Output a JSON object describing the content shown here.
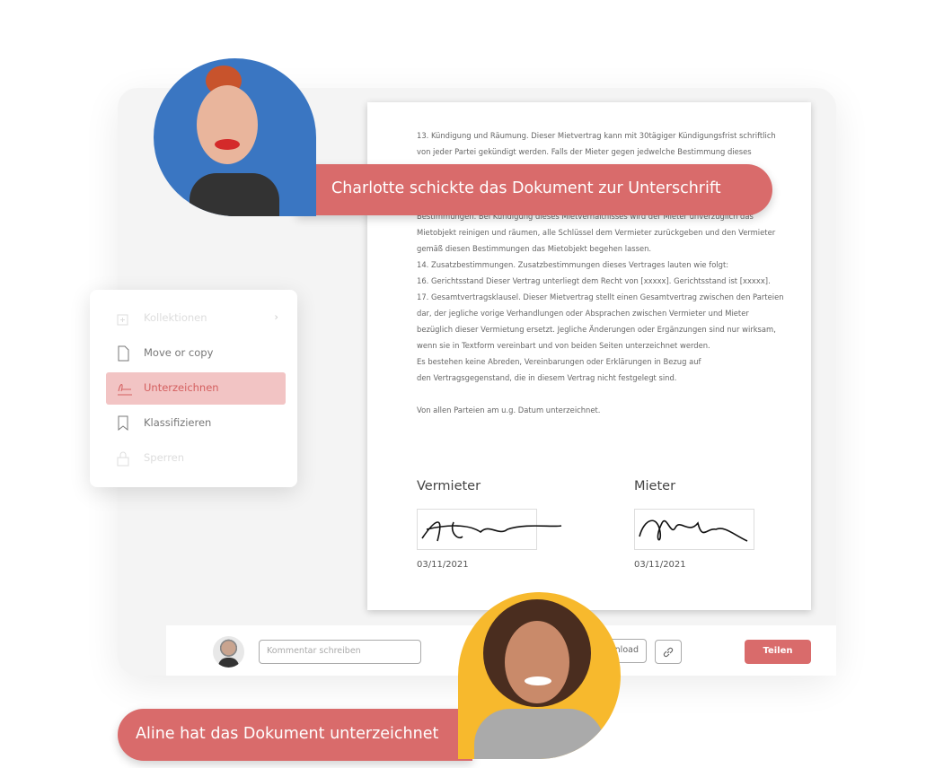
{
  "document": {
    "lines": [
      "13. Kündigung  und Räumung. Dieser Mietvertrag kann mit 30tägiger Kündigungsfrist schriftlich",
      "von jeder Partei gekündigt werden. Falls der Mieter gegen jedwelche Bestimmung dieses",
      "",
      "",
      "",
      "Bestimmungen.  Bei Kündigung dieses Mietverhältnisses wird der Mieter unverzüglich das",
      "Mietobjekt reinigen und räumen, alle Schlüssel dem Vermieter zurückgeben und den Vermieter",
      "gemäß  diesen Bestimmungen das Mietobjekt begehen lassen.",
      "14. Zusatzbestimmungen.  Zusatzbestimmungen dieses Vertrages lauten wie folgt:",
      "16. Gerichtsstand  Dieser Vertrag unterliegt dem Recht von [xxxxx]. Gerichtsstand ist [xxxxx].",
      "17. Gesamtvertragsklausel.  Dieser Mietvertrag stellt einen Gesamtvertrag zwischen den Parteien",
      "dar, der jegliche vorige Verhandlungen oder Absprachen zwischen Vermieter und Mieter",
      "bezüglich dieser Vermietung ersetzt. Jegliche Änderungen oder Ergänzungen sind nur wirksam,",
      "wenn sie in Textform vereinbart und von beiden Seiten unterzeichnet werden.",
      "Es bestehen keine Abreden, Vereinbarungen oder Erklärungen in Bezug auf",
      "den Vertragsgegenstand, die in diesem Vertrag nicht festgelegt sind.",
      "",
      "Von allen Parteien am u.g. Datum unterzeichnet."
    ],
    "landlord_label": "Vermieter",
    "tenant_label": "Mieter",
    "landlord_date": "03/11/2021",
    "tenant_date": "03/11/2021"
  },
  "menu": {
    "items": [
      {
        "label": "Kollektionen",
        "icon": "collection-add-icon",
        "state": "disabled"
      },
      {
        "label": "Move or copy",
        "icon": "file-icon",
        "state": "normal"
      },
      {
        "label": "Unterzeichnen",
        "icon": "signature-icon",
        "state": "active"
      },
      {
        "label": "Klassifizieren",
        "icon": "bookmark-icon",
        "state": "normal"
      },
      {
        "label": "Sperren",
        "icon": "lock-icon",
        "state": "disabled"
      }
    ]
  },
  "toolbar": {
    "comment_placeholder": "Kommentar schreiben",
    "download_label": "Download",
    "share_label": "Teilen"
  },
  "notifications": {
    "sent": "Charlotte schickte das Dokument zur Unterschrift",
    "signed": "Aline hat das Dokument unterzeichnet"
  },
  "colors": {
    "accent": "#d96b6b",
    "active_bg": "#f2c4c4",
    "charlotte_bg": "#3a76c2",
    "aline_bg": "#f7b92d"
  }
}
